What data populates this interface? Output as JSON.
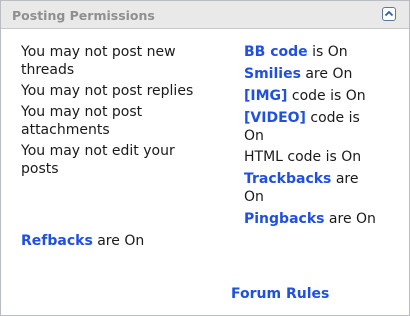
{
  "panel": {
    "title": "Posting Permissions",
    "collapse_icon": "chevron-up-icon"
  },
  "permissions": {
    "new_threads_1": "You may not post new",
    "new_threads_2": "threads",
    "replies": "You may not post replies",
    "attachments_1": "You may not post",
    "attachments_2": "attachments",
    "edit_1": "You may not edit your",
    "edit_2": "posts"
  },
  "settings": {
    "bbcode_label": "BB code",
    "bbcode_status": " is On",
    "smilies_label": "Smilies",
    "smilies_status": " are On",
    "img_label": "[IMG]",
    "img_status": " code is On",
    "video_label": "[VIDEO]",
    "video_status": " code is",
    "video_status_2": "On",
    "html_text": "HTML code is On",
    "trackbacks_label": "Trackbacks",
    "trackbacks_status": " are",
    "trackbacks_status_2": "On",
    "pingbacks_label": "Pingbacks",
    "pingbacks_status": " are On",
    "refbacks_label": "Refbacks",
    "refbacks_status": " are On"
  },
  "footer": {
    "forum_rules": "Forum Rules"
  },
  "colors": {
    "link": "#1f4fe3",
    "header_bg": "#e9e9e9",
    "header_text": "#8f8f8f",
    "border": "#b9bcc0"
  }
}
